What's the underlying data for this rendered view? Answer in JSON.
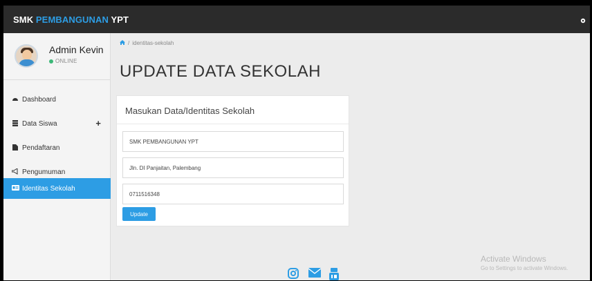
{
  "topbar": {
    "brand_prefix": "SMK ",
    "brand_accent": "PEMBANGUNAN",
    "brand_suffix": " YPT",
    "settings_icon": "gear-icon"
  },
  "user": {
    "name": "Admin Kevin",
    "status": "ONLINE",
    "status_color": "#3cb878"
  },
  "sidebar": {
    "items": [
      {
        "label": "Dashboard",
        "icon": "dashboard-icon"
      },
      {
        "label": "Data Siswa",
        "icon": "database-icon",
        "expand": "+"
      },
      {
        "label": "Pendaftaran",
        "icon": "file-icon"
      },
      {
        "label": "Pengumuman",
        "icon": "bullhorn-icon"
      },
      {
        "label": "Identitas Sekolah",
        "icon": "id-card-icon",
        "active": true
      }
    ]
  },
  "breadcrumb": {
    "current": "identitas-sekolah"
  },
  "page": {
    "title": "UPDATE DATA SEKOLAH"
  },
  "form": {
    "card_title": "Masukan Data/Identitas Sekolah",
    "school_name": "SMK PEMBANGUNAN YPT",
    "address": "Jln. DI Panjaitan, Palembang",
    "phone": "0711516348",
    "submit_label": "Update"
  },
  "footer": {
    "icons": [
      "instagram-icon",
      "mail-icon",
      "youtube-icon"
    ]
  },
  "watermark": {
    "title": "Activate Windows",
    "subtitle": "Go to Settings to activate Windows."
  },
  "colors": {
    "accent": "#2d9de4",
    "topbar": "#2b2b2b"
  }
}
